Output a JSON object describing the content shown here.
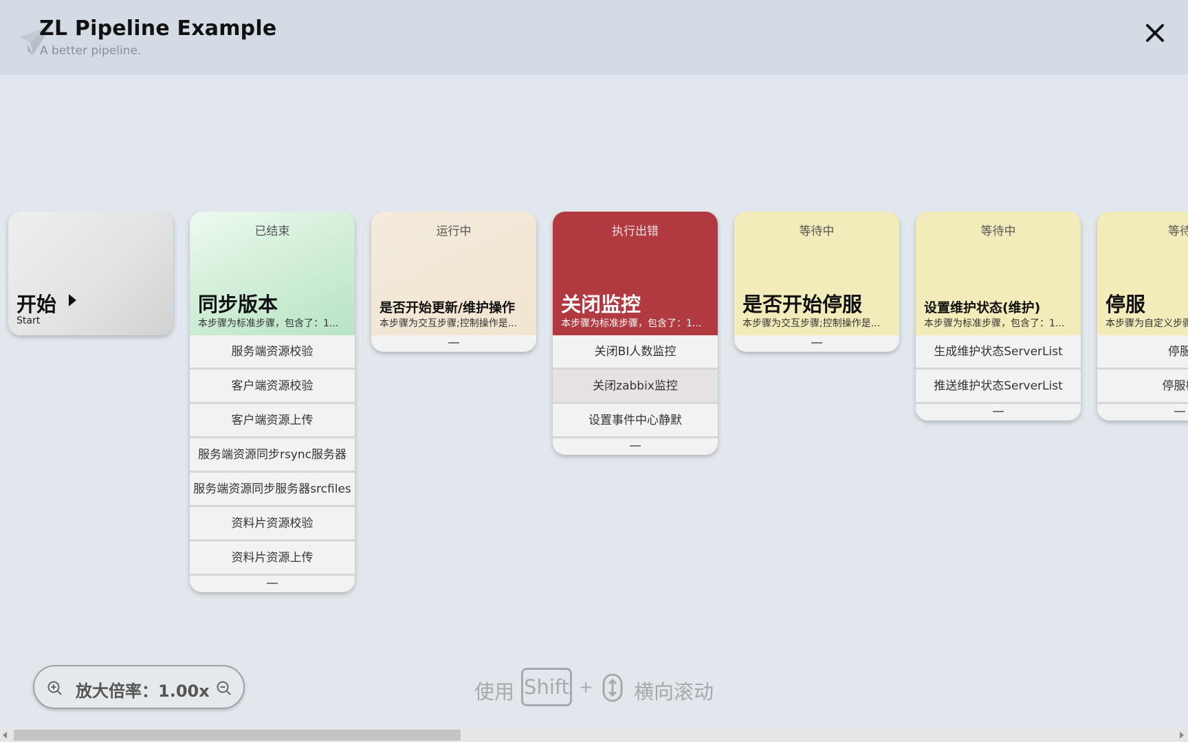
{
  "header": {
    "title": "ZL Pipeline Example",
    "subtitle": "A better pipeline.",
    "close_icon": "close-icon"
  },
  "start": {
    "label": "开始",
    "sub": "Start"
  },
  "stages": [
    {
      "status": "已结束",
      "name": "同步版本",
      "desc": "本步骤为标准步骤，包含了：1...",
      "color": "#bfe8cc",
      "items": [
        "服务端资源校验",
        "客户端资源校验",
        "客户端资源上传",
        "服务端资源同步rsync服务器",
        "服务端资源同步服务器srcfiles",
        "资料片资源校验",
        "资料片资源上传"
      ]
    },
    {
      "status": "运行中",
      "name": "是否开始更新/维护操作",
      "desc": "本步骤为交互步骤;控制操作是...",
      "color": "#f1e6d2",
      "items": []
    },
    {
      "status": "执行出错",
      "name": "关闭监控",
      "desc": "本步骤为标准步骤，包含了：1...",
      "color": "#b03a3f",
      "items": [
        "关闭BI人数监控",
        "关闭zabbix监控",
        "设置事件中心静默"
      ]
    },
    {
      "status": "等待中",
      "name": "是否开始停服",
      "desc": "本步骤为交互步骤;控制操作是...",
      "color": "#f2ecbb",
      "items": []
    },
    {
      "status": "等待中",
      "name": "设置维护状态(维护)",
      "desc": "本步骤为标准步骤，包含了：1...",
      "color": "#f2ecbb",
      "items": [
        "生成维护状态ServerList",
        "推送维护状态ServerList"
      ]
    },
    {
      "status": "等待",
      "name": "停服",
      "desc": "本步骤为自定义步骤",
      "color": "#f2ecbb",
      "items": [
        "停服",
        "停服检"
      ]
    }
  ],
  "zoom": {
    "label": "放大倍率：",
    "value": "1.00x"
  },
  "hint": {
    "use": "使用",
    "key": "Shift",
    "plus": "+",
    "scroll": "横向滚动"
  }
}
